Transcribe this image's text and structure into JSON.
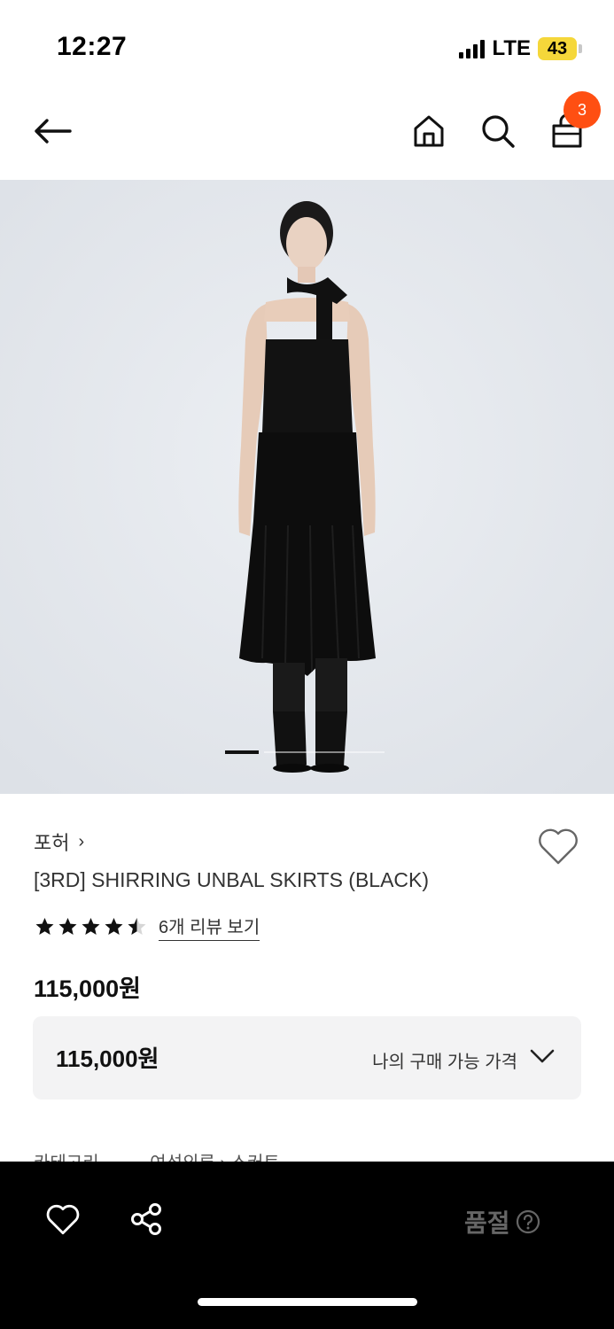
{
  "status_bar": {
    "time": "12:27",
    "network": "LTE",
    "battery": "43",
    "battery_color": "#f5d73a"
  },
  "nav": {
    "back_icon": "arrow-left-icon",
    "home_icon": "home-icon",
    "search_icon": "search-icon",
    "bag_icon": "shopping-bag-icon",
    "bag_count": "3",
    "badge_color": "#ff4f12"
  },
  "gallery": {
    "current_page": 1
  },
  "product": {
    "brand": "포허",
    "brand_chevron": "›",
    "title": "[3RD] SHIRRING UNBAL SKIRTS (BLACK)",
    "rating": 4.5,
    "review_link": "6개 리뷰 보기",
    "price": "115,000원",
    "price_box": {
      "value": "115,000원",
      "label": "나의 구매 가능 가격"
    },
    "category_label": "카테고리",
    "category_path_1": "여성의류",
    "category_path_sep": "›",
    "category_path_2": "스커트"
  },
  "bottom_bar": {
    "wish_icon": "heart-icon",
    "share_icon": "share-icon",
    "status": "품절",
    "help_icon": "question-circle-icon"
  }
}
